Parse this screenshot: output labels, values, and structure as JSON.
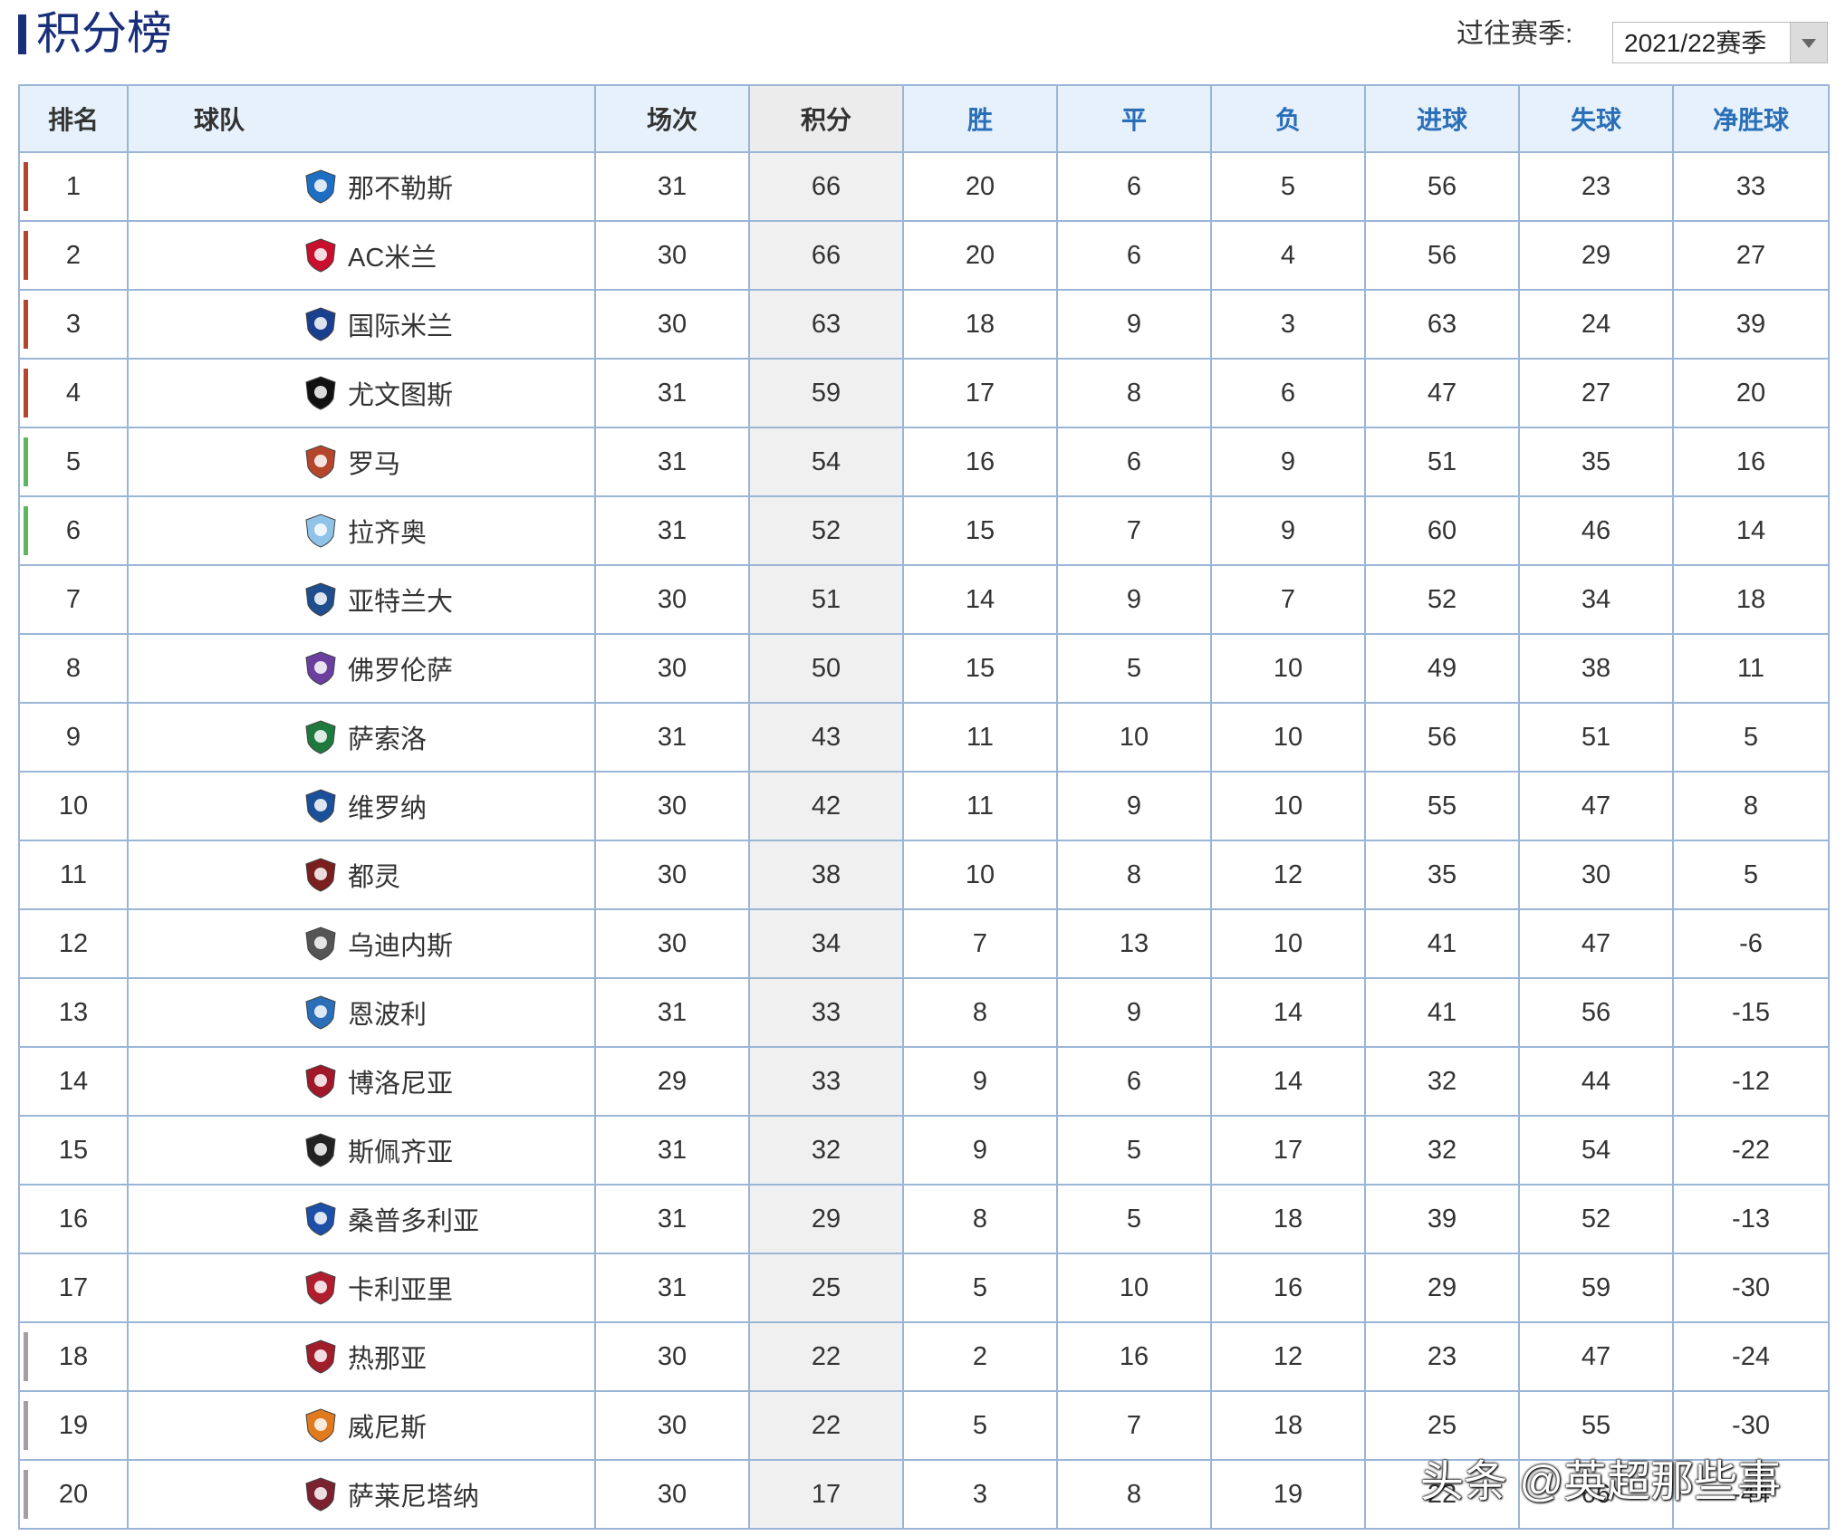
{
  "header": {
    "title": "积分榜",
    "season_label": "过往赛季:",
    "season_value": "2021/22赛季"
  },
  "columns": [
    "排名",
    "球队",
    "场次",
    "积分",
    "胜",
    "平",
    "负",
    "进球",
    "失球",
    "净胜球"
  ],
  "zone_colors": {
    "cl": "#b5462b",
    "el": "#5cb85c",
    "rel": "#a0a0a0"
  },
  "rows": [
    {
      "rank": "1",
      "team": "那不勒斯",
      "played": "31",
      "points": "66",
      "won": "20",
      "drawn": "6",
      "lost": "5",
      "gf": "56",
      "ga": "23",
      "gd": "33",
      "zone": "cl",
      "logo_color": "#1d6fc4",
      "logo_icon": "napoli-logo"
    },
    {
      "rank": "2",
      "team": "AC米兰",
      "played": "30",
      "points": "66",
      "won": "20",
      "drawn": "6",
      "lost": "4",
      "gf": "56",
      "ga": "29",
      "gd": "27",
      "zone": "cl",
      "logo_color": "#c8102e",
      "logo_icon": "ac-milan-logo"
    },
    {
      "rank": "3",
      "team": "国际米兰",
      "played": "30",
      "points": "63",
      "won": "18",
      "drawn": "9",
      "lost": "3",
      "gf": "63",
      "ga": "24",
      "gd": "39",
      "zone": "cl",
      "logo_color": "#1a3f8f",
      "logo_icon": "inter-logo"
    },
    {
      "rank": "4",
      "team": "尤文图斯",
      "played": "31",
      "points": "59",
      "won": "17",
      "drawn": "8",
      "lost": "6",
      "gf": "47",
      "ga": "27",
      "gd": "20",
      "zone": "cl",
      "logo_color": "#111111",
      "logo_icon": "juventus-logo"
    },
    {
      "rank": "5",
      "team": "罗马",
      "played": "31",
      "points": "54",
      "won": "16",
      "drawn": "6",
      "lost": "9",
      "gf": "51",
      "ga": "35",
      "gd": "16",
      "zone": "el",
      "logo_color": "#b5462b",
      "logo_icon": "roma-logo"
    },
    {
      "rank": "6",
      "team": "拉齐奥",
      "played": "31",
      "points": "52",
      "won": "15",
      "drawn": "7",
      "lost": "9",
      "gf": "60",
      "ga": "46",
      "gd": "14",
      "zone": "el",
      "logo_color": "#8fc3e8",
      "logo_icon": "lazio-logo"
    },
    {
      "rank": "7",
      "team": "亚特兰大",
      "played": "30",
      "points": "51",
      "won": "14",
      "drawn": "9",
      "lost": "7",
      "gf": "52",
      "ga": "34",
      "gd": "18",
      "zone": "",
      "logo_color": "#1f4e8f",
      "logo_icon": "atalanta-logo"
    },
    {
      "rank": "8",
      "team": "佛罗伦萨",
      "played": "30",
      "points": "50",
      "won": "15",
      "drawn": "5",
      "lost": "10",
      "gf": "49",
      "ga": "38",
      "gd": "11",
      "zone": "",
      "logo_color": "#6a3fa0",
      "logo_icon": "fiorentina-logo"
    },
    {
      "rank": "9",
      "team": "萨索洛",
      "played": "31",
      "points": "43",
      "won": "11",
      "drawn": "10",
      "lost": "10",
      "gf": "56",
      "ga": "51",
      "gd": "5",
      "zone": "",
      "logo_color": "#1e7a3c",
      "logo_icon": "sassuolo-logo"
    },
    {
      "rank": "10",
      "team": "维罗纳",
      "played": "30",
      "points": "42",
      "won": "11",
      "drawn": "9",
      "lost": "10",
      "gf": "55",
      "ga": "47",
      "gd": "8",
      "zone": "",
      "logo_color": "#1a4f9a",
      "logo_icon": "verona-logo"
    },
    {
      "rank": "11",
      "team": "都灵",
      "played": "30",
      "points": "38",
      "won": "10",
      "drawn": "8",
      "lost": "12",
      "gf": "35",
      "ga": "30",
      "gd": "5",
      "zone": "",
      "logo_color": "#7a1e1e",
      "logo_icon": "torino-logo"
    },
    {
      "rank": "12",
      "team": "乌迪内斯",
      "played": "30",
      "points": "34",
      "won": "7",
      "drawn": "13",
      "lost": "10",
      "gf": "41",
      "ga": "47",
      "gd": "-6",
      "zone": "",
      "logo_color": "#555555",
      "logo_icon": "udinese-logo"
    },
    {
      "rank": "13",
      "team": "恩波利",
      "played": "31",
      "points": "33",
      "won": "8",
      "drawn": "9",
      "lost": "14",
      "gf": "41",
      "ga": "56",
      "gd": "-15",
      "zone": "",
      "logo_color": "#2a6fb8",
      "logo_icon": "empoli-logo"
    },
    {
      "rank": "14",
      "team": "博洛尼亚",
      "played": "29",
      "points": "33",
      "won": "9",
      "drawn": "6",
      "lost": "14",
      "gf": "32",
      "ga": "44",
      "gd": "-12",
      "zone": "",
      "logo_color": "#a0182a",
      "logo_icon": "bologna-logo"
    },
    {
      "rank": "15",
      "team": "斯佩齐亚",
      "played": "31",
      "points": "32",
      "won": "9",
      "drawn": "5",
      "lost": "17",
      "gf": "32",
      "ga": "54",
      "gd": "-22",
      "zone": "",
      "logo_color": "#222222",
      "logo_icon": "spezia-logo"
    },
    {
      "rank": "16",
      "team": "桑普多利亚",
      "played": "31",
      "points": "29",
      "won": "8",
      "drawn": "5",
      "lost": "18",
      "gf": "39",
      "ga": "52",
      "gd": "-13",
      "zone": "",
      "logo_color": "#1c4fa8",
      "logo_icon": "sampdoria-logo"
    },
    {
      "rank": "17",
      "team": "卡利亚里",
      "played": "31",
      "points": "25",
      "won": "5",
      "drawn": "10",
      "lost": "16",
      "gf": "29",
      "ga": "59",
      "gd": "-30",
      "zone": "",
      "logo_color": "#b01e2e",
      "logo_icon": "cagliari-logo"
    },
    {
      "rank": "18",
      "team": "热那亚",
      "played": "30",
      "points": "22",
      "won": "2",
      "drawn": "16",
      "lost": "12",
      "gf": "23",
      "ga": "47",
      "gd": "-24",
      "zone": "rel",
      "logo_color": "#a01d2a",
      "logo_icon": "genoa-logo"
    },
    {
      "rank": "19",
      "team": "威尼斯",
      "played": "30",
      "points": "22",
      "won": "5",
      "drawn": "7",
      "lost": "18",
      "gf": "25",
      "ga": "55",
      "gd": "-30",
      "zone": "rel",
      "logo_color": "#e07a1e",
      "logo_icon": "venezia-logo"
    },
    {
      "rank": "20",
      "team": "萨莱尼塔纳",
      "played": "30",
      "points": "17",
      "won": "3",
      "drawn": "8",
      "lost": "19",
      "gf": "22",
      "ga": "66",
      "gd": "-44",
      "zone": "rel",
      "logo_color": "#7a2230",
      "logo_icon": "salernitana-logo"
    }
  ],
  "watermark": "头条 @英超那些事"
}
